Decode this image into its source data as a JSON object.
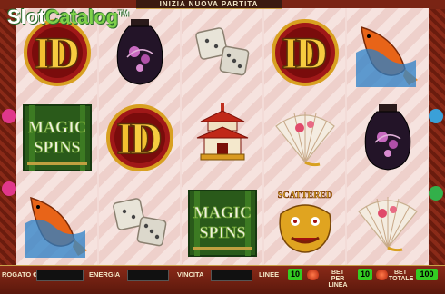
{
  "banner": {
    "title": "INIZIA NUOVA PARTITA"
  },
  "watermark": {
    "brand_a": "Slot",
    "brand_b": "Catalog",
    "tm": "TM"
  },
  "reels": [
    [
      "wild-d",
      "magic-spins",
      "koi-fish"
    ],
    [
      "vase",
      "wild-d",
      "dice"
    ],
    [
      "dice",
      "pagoda",
      "magic-spins"
    ],
    [
      "wild-d",
      "fan",
      "scatter-dragon"
    ],
    [
      "koi-fish",
      "vase",
      "fan"
    ]
  ],
  "symbol_text": {
    "wild": "D",
    "magic_line1": "MAGIC",
    "magic_line2": "SPINS",
    "scatter": "SCATTERED"
  },
  "bottom_bar": {
    "credit_label": "ROGATO €",
    "energy_label": "ENERGIA",
    "win_label": "VINCITA",
    "lines_label": "LINEE",
    "lines_value": "10",
    "bet_line_label_1": "BET",
    "bet_line_label_2": "PER LINEA",
    "bet_line_value": "10",
    "bet_total_label_1": "BET",
    "bet_total_label_2": "TOTALE",
    "bet_total_value": "100"
  },
  "colors": {
    "frame": "#7a2414",
    "accent_green": "#33cc22",
    "gold": "#c9a24a"
  }
}
